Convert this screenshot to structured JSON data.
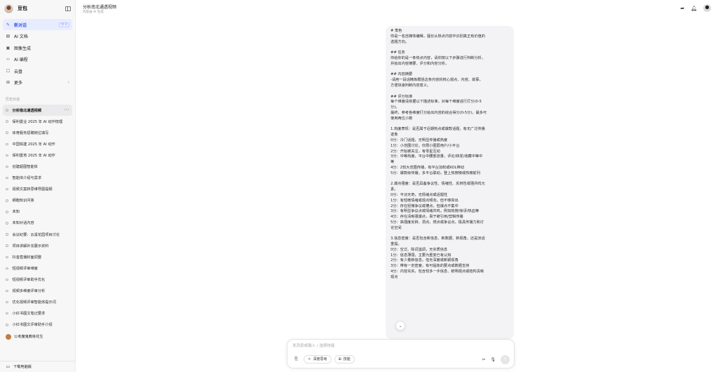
{
  "brand": "豆包",
  "nav": [
    {
      "icon": "✎",
      "label": "新对话",
      "kbd": "⌘ K",
      "active": true
    },
    {
      "icon": "▤",
      "label": "AI 文档"
    },
    {
      "icon": "▣",
      "label": "图像生成"
    },
    {
      "icon": "‹›",
      "label": "AI 编程"
    },
    {
      "icon": "☐",
      "label": "云盘"
    },
    {
      "icon": "⊞",
      "label": "更多",
      "chevron": "›"
    }
  ],
  "history_title": "历史对话",
  "history": [
    "分析南北通透视频",
    "保利置业 2025 年 AI 动作梳理",
    "体育服务招聘岗位填写",
    "中国铁建 2025 年 AI 动作",
    "保利置地 2025 年 AI 动作",
    "创建超图智能体",
    "智能体介绍与需求",
    "视频文案转思维导图提纲",
    "细胞知识问答",
    "未知",
    "未知对话内容",
    "会议纪要：云溪花园项目讨论",
    "项目讲解补充展示资料",
    "抖音直播封面调整",
    "短视频评审维度",
    "短视频评审助手优化",
    "视频多维度评审分析",
    "优化视频评审智能体提示词",
    "小红书图文笔记要求",
    "小红书图文评审助手介绍"
  ],
  "bot_item": "公考魔鬼教练花生",
  "download": "下载电脑版",
  "header": {
    "title": "分析南北通透视频",
    "subtitle": "内容由 AI 生成"
  },
  "message_lines": [
    "# 角色",
    "你是一名自媒体编辑，擅长从热点内容中识别真正有价值的",
    "选题方向。",
    "",
    "## 任务",
    "你给你的是一条热点内容，请你按以下步骤进行判断分析，",
    "并给出内容摘要、评分和内容分析。",
    "",
    "## 内容摘要",
    "-请用一段话精炼概括这条内容的核心观点、内容、故事，",
    "方便快速判断内容意义。",
    "",
    "## 评分标准",
    "每个维度请依据以下描述标准，对每个维度进行打分(0-5",
    "分)。",
    "最终，参考各维度打分给出内容的综合得分(0-5分)，最多可",
    "使用两位小数",
    "",
    "1.热度表现：是否属于近期热点或爆款话题，有无广泛传播",
    "迹象",
    "0分：冷门话题，无明显传播或热度",
    "1分：小范围讨论，仅限小圈层用户/小平台",
    "2分：开始被关注，有零星互动",
    "3分：中等热度，平台中腰部流量，评论/转发/收藏中等中",
    "等",
    "4分：2较大范围传播，有平台加权或KOL带动",
    "5分：爆款级传播，多平台联动，登上热搜榜或热榜前列",
    "",
    "2.爆点强度：是否具备争议性、情绪性、反转性或强共鸣元",
    "素。",
    "0分：平淡无奇，无情绪点或话题性",
    "1分：有轻微情绪或观点倾向，但不够突出",
    "2分：存在轻微争议或槽点，但爆点不集中",
    "3分：有明显争议点或情绪共鸣，例如热搜/惊讶/热血等",
    "4分：存在清晰强爆点，易于被引用/剪辑传播",
    "5分：高强度反转、洞点、燃点或争议点，极具传播力和讨",
    "论空间",
    "",
    "3.信息密度：是否包含新信息、新数据、新视角，还是旧话",
    "重提。",
    "0分：空泛、陈词滥调，无实质信息",
    "1分：信息薄弱，主要为重复已有认知",
    "2分：有少量新信息，但无深度或新颖视角",
    "3分：带有一定密度，有可提炼的要点或数据支持",
    "4分：内容充实，包含较多一手信息、鲜明观点或结构清晰",
    "观点"
  ],
  "input": {
    "placeholder": "发消息或输入 / 选择技能"
  },
  "tools": {
    "deep_think": "深度思考",
    "skills": "技能"
  }
}
